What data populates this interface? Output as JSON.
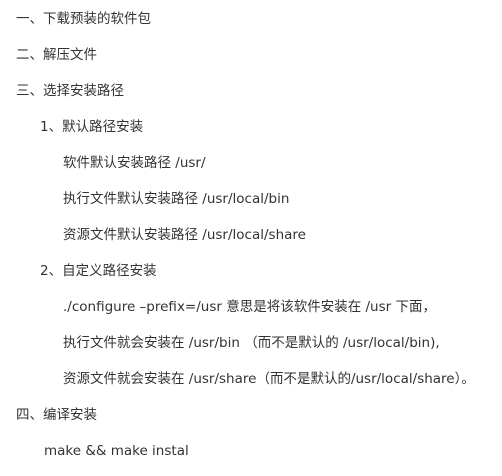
{
  "lines": [
    "一、下载预装的软件包",
    "二、解压文件",
    "三、选择安装路径",
    "1、默认路径安装",
    "软件默认安装路径  /usr/",
    "执行文件默认安装路径  /usr/local/bin",
    "资源文件默认安装路径 /usr/local/share",
    "2、自定义路径安装",
    "./configure –prefix=/usr 意思是将该软件安装在 /usr 下面，",
    "执行文件就会安装在 /usr/bin （而不是默认的 /usr/local/bin),",
    "资源文件就会安装在 /usr/share（而不是默认的/usr/local/share）。",
    "四、编译安装",
    "make && make instal"
  ]
}
